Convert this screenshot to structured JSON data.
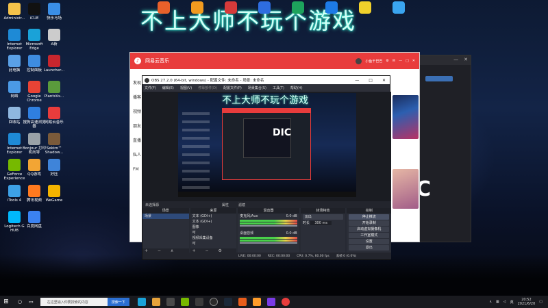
{
  "desktop": {
    "banner": "不上大师不玩个游戏",
    "icons": [
      {
        "label": "Administr...",
        "color": "#f5c34a"
      },
      {
        "label": "iCUE",
        "color": "#111"
      },
      {
        "label": "快乐马场",
        "color": "#3a8ee6"
      },
      {
        "label": "Internet Explorer",
        "color": "#1e8ad6"
      },
      {
        "label": "Microsoft Edge",
        "color": "#1aa2d8"
      },
      {
        "label": "A新",
        "color": "#ccc"
      },
      {
        "label": "此电脑",
        "color": "#5aa0e6"
      },
      {
        "label": "控制面板",
        "color": "#3e8ce0"
      },
      {
        "label": "Launcher...",
        "color": "#c8262e"
      },
      {
        "label": "网络",
        "color": "#4b9ae6"
      },
      {
        "label": "Google Chrome",
        "color": "#e94335"
      },
      {
        "label": "PlantsVs...",
        "color": "#5a9b3c"
      },
      {
        "label": "回收站",
        "color": "#8fb7df"
      },
      {
        "label": "搜狗高速浏览器",
        "color": "#2f7fe0"
      },
      {
        "label": "网易云音乐",
        "color": "#e83c3c"
      },
      {
        "label": "Internet Explorer",
        "color": "#1e8ad6"
      },
      {
        "label": "Bonjour 打印机向导",
        "color": "#9aa2a8"
      },
      {
        "label": "Sekiro™ Shadow...",
        "color": "#7a5a3a"
      },
      {
        "label": "GeForce Experience",
        "color": "#76b900"
      },
      {
        "label": "QQ游戏",
        "color": "#f2a534"
      },
      {
        "label": "好压",
        "color": "#3f84d9"
      },
      {
        "label": "iTools 4",
        "color": "#3da1e6"
      },
      {
        "label": "腾讯视频",
        "color": "#ff7a1f"
      },
      {
        "label": "WeGame",
        "color": "#f4b400"
      },
      {
        "label": "Logitech G HUB",
        "color": "#00b8fc"
      },
      {
        "label": "百度网盘",
        "color": "#3b82f0"
      }
    ]
  },
  "netease": {
    "title": "网易云音乐",
    "username": "小鱼干巴巴",
    "side": [
      "发现",
      "播客",
      "视频",
      "朋友",
      "直播",
      "私人FM"
    ]
  },
  "obs": {
    "title": "OBS 27.2.0 (64-bit, windows) - 配置文件: 未命名 - 场景: 未命名",
    "menu": [
      "文件(F)",
      "编辑(E)",
      "视图(V)",
      "停靠部件(D)",
      "配置文件(P)",
      "场景集合(S)",
      "工具(T)",
      "帮助(H)"
    ],
    "preview_text": "不上大师不玩个游戏",
    "no_source": "未选择源",
    "props_btn": "属性",
    "filter_btn": "滤镜",
    "scenes": {
      "header": "场景",
      "items": [
        "场景"
      ]
    },
    "sources": {
      "header": "来源",
      "items": [
        "文本 (GDI+)",
        "文本 (GDI+)",
        "图像",
        "可",
        "视频采集设备",
        "可"
      ]
    },
    "mixer": {
      "header": "混音器",
      "tracks": [
        {
          "name": "麦克风/Aux",
          "db": "0.0 dB"
        },
        {
          "name": "桌面音频",
          "db": "0.0 dB"
        }
      ]
    },
    "transitions": {
      "header": "转场特效",
      "type": "淡出",
      "duration_label": "时长",
      "duration": "300 ms"
    },
    "controls": {
      "header": "控制",
      "buttons": [
        "停止推流",
        "开始录制",
        "启动虚拟摄像机",
        "工作室模式",
        "设置",
        "退出"
      ]
    },
    "status": {
      "live": "LIVE: 00:00:00",
      "rec": "REC: 00:00:00",
      "cpu": "CPU: 0.7%, 60.00 fps",
      "drop": "丢帧 0 (0.0%)"
    }
  },
  "taskbar": {
    "search_placeholder": "在这里输入你要搜索的内容",
    "search_button": "搜索一下",
    "tray_text": "英",
    "time": "20:52",
    "date": "2021/6/20"
  }
}
